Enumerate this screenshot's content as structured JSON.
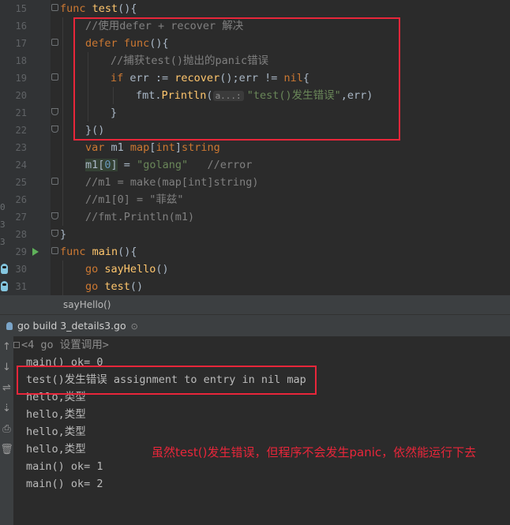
{
  "editor": {
    "gutter_fragments": [
      "0",
      "3",
      "3"
    ],
    "lines": [
      {
        "no": "15",
        "fold": "start",
        "indent": 0,
        "tokens": [
          {
            "t": "func ",
            "c": "kw"
          },
          {
            "t": "test",
            "c": "fn"
          },
          {
            "t": "(){",
            "c": ""
          }
        ]
      },
      {
        "no": "16",
        "indent": 1,
        "tokens": [
          {
            "t": "//使用defer + recover 解决",
            "c": "cm"
          }
        ]
      },
      {
        "no": "17",
        "fold": "start",
        "indent": 1,
        "tokens": [
          {
            "t": "defer ",
            "c": "kw"
          },
          {
            "t": "func",
            "c": "kw"
          },
          {
            "t": "(){",
            "c": ""
          }
        ]
      },
      {
        "no": "18",
        "indent": 2,
        "tokens": [
          {
            "t": "//捕获test()抛出的panic错误",
            "c": "cm"
          }
        ]
      },
      {
        "no": "19",
        "fold": "start",
        "indent": 2,
        "tokens": [
          {
            "t": "if ",
            "c": "kw"
          },
          {
            "t": "err := ",
            "c": ""
          },
          {
            "t": "recover",
            "c": "fn"
          },
          {
            "t": "();err != ",
            "c": ""
          },
          {
            "t": "nil",
            "c": "kw"
          },
          {
            "t": "{",
            "c": ""
          }
        ]
      },
      {
        "no": "20",
        "indent": 3,
        "tokens": [
          {
            "t": "fmt.",
            "c": ""
          },
          {
            "t": "Println",
            "c": "fn"
          },
          {
            "t": "(",
            "c": ""
          },
          {
            "t": "a...:",
            "c": "hint"
          },
          {
            "t": "\"test()发生错误\"",
            "c": "str"
          },
          {
            "t": ",err)",
            "c": ""
          }
        ]
      },
      {
        "no": "21",
        "fold": "end",
        "indent": 2,
        "tokens": [
          {
            "t": "}",
            "c": ""
          }
        ]
      },
      {
        "no": "22",
        "fold": "end",
        "indent": 1,
        "tokens": [
          {
            "t": "}()",
            "c": ""
          }
        ]
      },
      {
        "no": "23",
        "indent": 1,
        "tokens": [
          {
            "t": "var ",
            "c": "kw"
          },
          {
            "t": "m1 ",
            "c": ""
          },
          {
            "t": "map",
            "c": "kw"
          },
          {
            "t": "[",
            "c": ""
          },
          {
            "t": "int",
            "c": "kw"
          },
          {
            "t": "]",
            "c": ""
          },
          {
            "t": "string",
            "c": "kw"
          }
        ]
      },
      {
        "no": "24",
        "indent": 1,
        "tokens": [
          {
            "t": "m1[",
            "c": "hl"
          },
          {
            "t": "0",
            "c": "num hl"
          },
          {
            "t": "]",
            "c": "hl"
          },
          {
            "t": " = ",
            "c": ""
          },
          {
            "t": "\"golang\"",
            "c": "str"
          },
          {
            "t": "   //error",
            "c": "cm"
          }
        ]
      },
      {
        "no": "25",
        "fold": "start",
        "indent": 1,
        "tokens": [
          {
            "t": "//m1 = make(map[int]string)",
            "c": "cm"
          }
        ]
      },
      {
        "no": "26",
        "indent": 1,
        "tokens": [
          {
            "t": "//m1[0] = \"菲兹\"",
            "c": "cm"
          }
        ]
      },
      {
        "no": "27",
        "fold": "end",
        "indent": 1,
        "tokens": [
          {
            "t": "//fmt.Println(m1)",
            "c": "cm"
          }
        ]
      },
      {
        "no": "28",
        "fold": "end",
        "indent": 0,
        "tokens": [
          {
            "t": "}",
            "c": ""
          }
        ]
      },
      {
        "no": "29",
        "fold": "start",
        "run": true,
        "indent": 0,
        "tokens": [
          {
            "t": "func ",
            "c": "kw"
          },
          {
            "t": "main",
            "c": "fn"
          },
          {
            "t": "(){",
            "c": ""
          }
        ]
      },
      {
        "no": "30",
        "gopher": true,
        "indent": 1,
        "tokens": [
          {
            "t": "go ",
            "c": "kw"
          },
          {
            "t": "sayHello",
            "c": "fn"
          },
          {
            "t": "()",
            "c": ""
          }
        ]
      },
      {
        "no": "31",
        "gopher": true,
        "indent": 1,
        "tokens": [
          {
            "t": "go ",
            "c": "kw"
          },
          {
            "t": "test",
            "c": "fn"
          },
          {
            "t": "()",
            "c": ""
          }
        ]
      }
    ]
  },
  "breadcrumb": "sayHello()",
  "run_panel": {
    "tab_label": "go build 3_details3.go",
    "close_glyph": "⊙",
    "toolbar": [
      {
        "name": "rerun-up-icon",
        "glyph": "↑"
      },
      {
        "name": "scroll-down-icon",
        "glyph": "↓"
      },
      {
        "name": "soft-wrap-icon",
        "glyph": "⇌"
      },
      {
        "name": "scroll-to-end-icon",
        "glyph": "⇣"
      },
      {
        "name": "print-icon",
        "glyph": "⎙"
      },
      {
        "name": "trash-icon",
        "glyph": "🗑"
      }
    ],
    "console_lines": [
      "<4 go 设置调用>",
      "main() ok= 0",
      "test()发生错误 assignment to entry in nil map",
      "hello,类型",
      "hello,类型",
      "hello,类型",
      "hello,类型",
      "main() ok= 1",
      "main() ok= 2"
    ]
  },
  "annotation": "虽然test()发生错误，但程序不会发生panic，依然能运行下去",
  "colors": {
    "highlight_box": "#e8263a",
    "keyword": "#cc7832",
    "function": "#ffc66d",
    "comment": "#808080",
    "string": "#6a8759"
  }
}
